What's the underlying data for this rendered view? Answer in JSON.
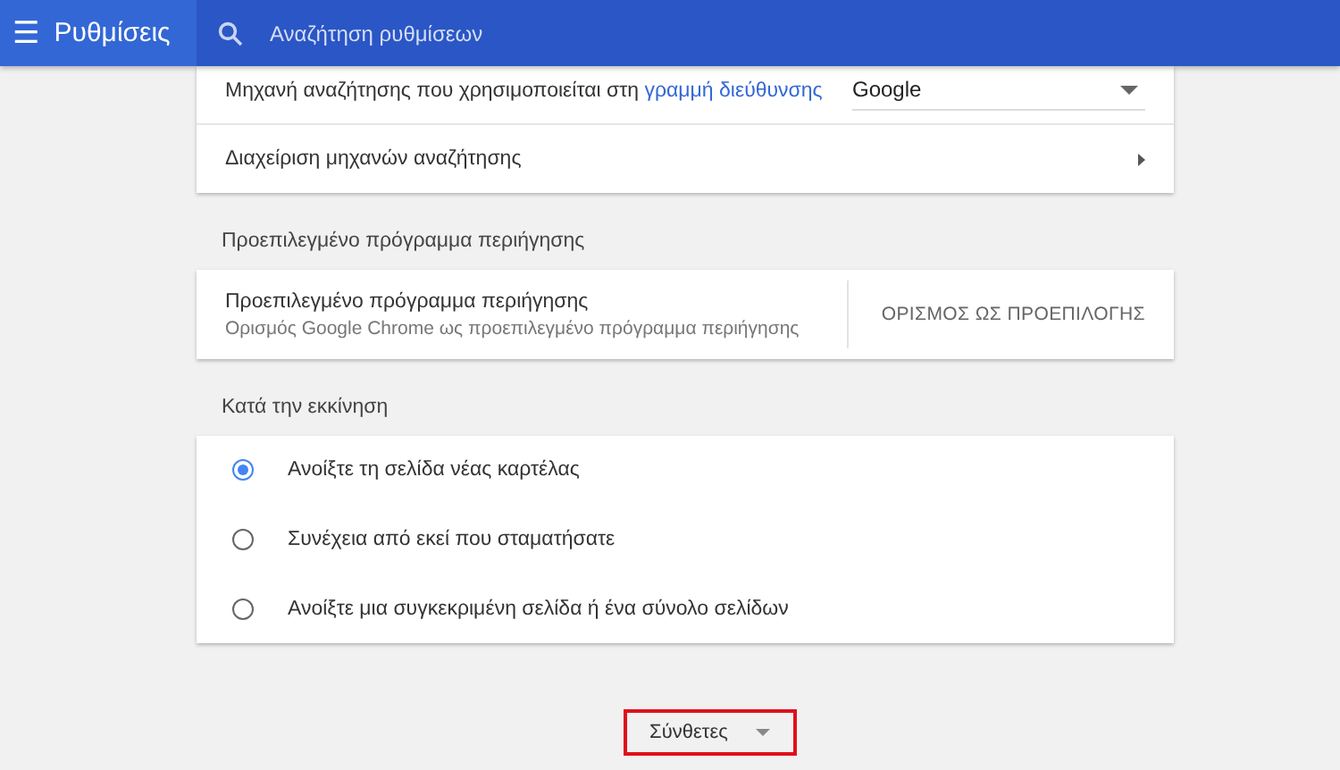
{
  "header": {
    "menu_icon": "☰",
    "title": "Ρυθμίσεις",
    "search": {
      "placeholder": "Αναζήτηση ρυθμίσεων"
    }
  },
  "search_engine_card": {
    "rows": [
      {
        "kind": "select",
        "label": "Μηχανή αναζήτησης που χρησιμοποιείται στη",
        "link": "γραμμή διεύθυνσης",
        "value": "Google"
      },
      {
        "kind": "link",
        "label": "Διαχείριση μηχανών αναζήτησης"
      }
    ]
  },
  "default_browser": {
    "heading": "Προεπιλεγμένο πρόγραμμα περιήγησης",
    "title": "Προεπιλεγμένο πρόγραμμα περιήγησης",
    "subtitle": "Ορισμός Google Chrome ως προεπιλεγμένο πρόγραμμα περιήγησης",
    "button": "ΟΡΙΣΜΟΣ ΩΣ ΠΡΟΕΠΙΛΟΓΗΣ"
  },
  "on_startup": {
    "heading": "Κατά την εκκίνηση",
    "options": [
      {
        "label": "Ανοίξτε τη σελίδα νέας καρτέλας",
        "selected": true
      },
      {
        "label": "Συνέχεια από εκεί που σταματήσατε",
        "selected": false
      },
      {
        "label": "Ανοίξτε μια συγκεκριμένη σελίδα ή ένα σύνολο σελίδων",
        "selected": false
      }
    ]
  },
  "advanced_button": {
    "label": "Σύνθετες",
    "highlighted": true
  }
}
